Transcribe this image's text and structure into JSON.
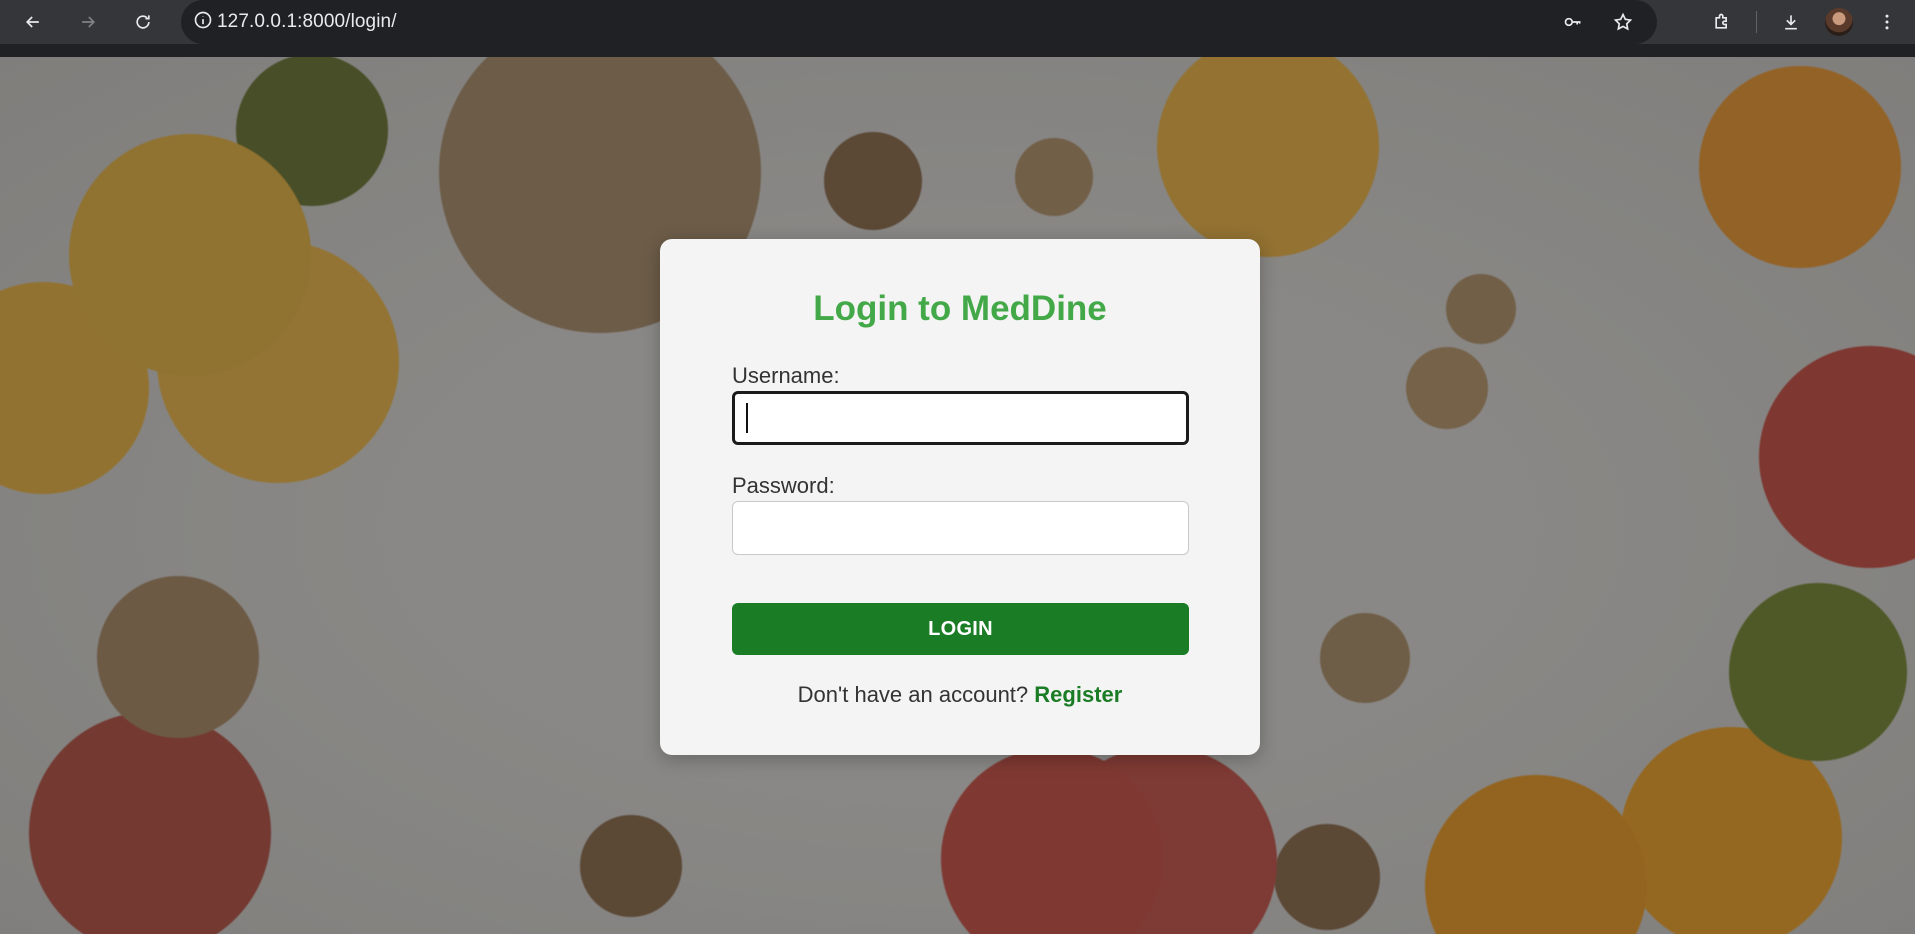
{
  "browser": {
    "url": "127.0.0.1:8000/login/",
    "icons": {
      "back": "back-arrow-icon",
      "forward": "forward-arrow-icon",
      "reload": "reload-icon",
      "site_info": "info-icon",
      "password": "key-icon",
      "bookmark": "star-icon",
      "extensions": "puzzle-icon",
      "downloads": "download-icon",
      "menu": "kebab-menu-icon"
    }
  },
  "login": {
    "title": "Login to MedDine",
    "username_label": "Username:",
    "username_value": "",
    "password_label": "Password:",
    "password_value": "",
    "submit_label": "LOGIN",
    "register_prompt": "Don't have an account?",
    "register_link": "Register"
  },
  "colors": {
    "title_green": "#43a848",
    "button_green": "#1b7c26",
    "card_bg": "#f4f4f4"
  }
}
